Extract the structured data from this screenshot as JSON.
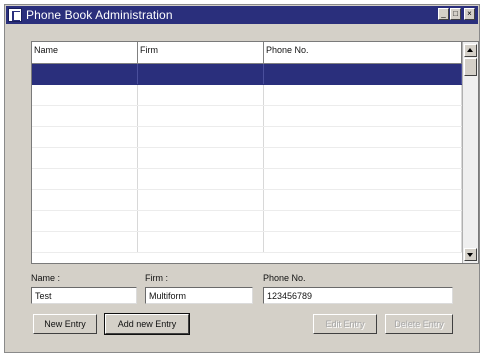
{
  "window": {
    "title": "Phone Book Administration"
  },
  "table": {
    "columns": [
      "Name",
      "Firm",
      "Phone No."
    ],
    "rows": [
      [
        "",
        "",
        ""
      ],
      [
        "",
        "",
        ""
      ],
      [
        "",
        "",
        ""
      ],
      [
        "",
        "",
        ""
      ],
      [
        "",
        "",
        ""
      ],
      [
        "",
        "",
        ""
      ],
      [
        "",
        "",
        ""
      ],
      [
        "",
        "",
        ""
      ],
      [
        "",
        "",
        ""
      ]
    ],
    "selected_row": 0
  },
  "form": {
    "name_label": "Name :",
    "name_value": "Test",
    "firm_label": "Firm :",
    "firm_value": "Multiform",
    "phone_label": "Phone No.",
    "phone_value": "123456789"
  },
  "buttons": {
    "new_entry": "New Entry",
    "add_new_entry": "Add new Entry",
    "edit_entry": "Edit Entry",
    "delete_entry": "Delete Entry"
  },
  "colors": {
    "titlebar": "#2a2f7c",
    "selection": "#2a2f7c",
    "window_bg": "#d4d0c8"
  }
}
